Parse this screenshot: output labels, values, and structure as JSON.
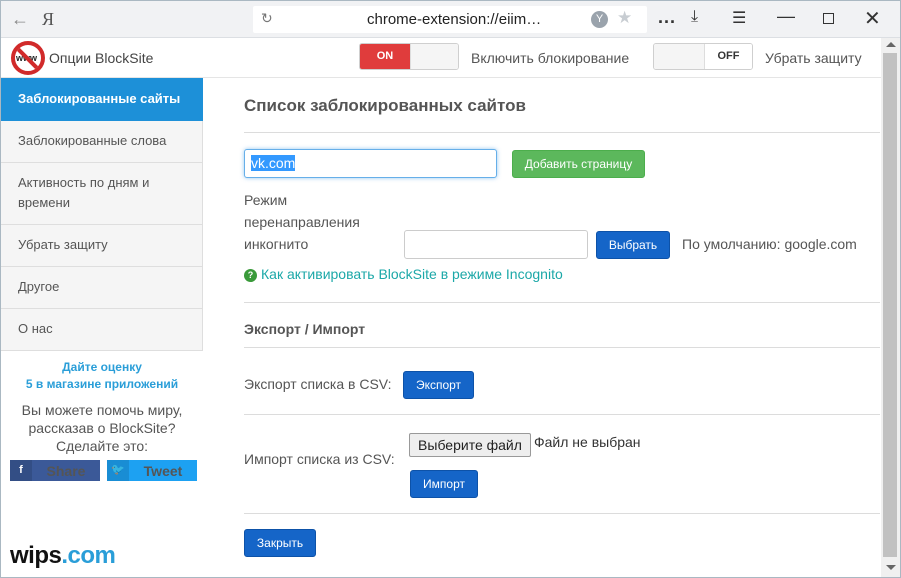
{
  "browser": {
    "back_glyph": "←",
    "ya_logo": "Я",
    "refresh_glyph": "↻",
    "url": "chrome-extension://eiim…",
    "ext_badge": "Y",
    "star_glyph": "★",
    "dots": "...",
    "download_glyph": "⤓",
    "menu_glyph": "☰",
    "minimize_glyph": "—",
    "close_glyph": "✕"
  },
  "header": {
    "app_title": "Опции BlockSite",
    "logo_text": "www",
    "toggle_block_state": "ON",
    "toggle_block_label": "Включить блокирование",
    "toggle_protect_state": "OFF",
    "toggle_protect_label": "Убрать защиту"
  },
  "sidebar": {
    "items": [
      {
        "label": "Заблокированные сайты",
        "active": true
      },
      {
        "label": "Заблокированные слова"
      },
      {
        "label": "Активность по дням и времени"
      },
      {
        "label": "Убрать защиту"
      },
      {
        "label": "Другое"
      },
      {
        "label": "О нас"
      }
    ],
    "rate_line1": "Дайте оценку",
    "rate_line2": "5 в магазине приложений",
    "help_line1": "Вы можете помочь миру,",
    "help_line2": "рассказав о BlockSite?",
    "help_line3": "Сделайте это:",
    "share_fb_icon": "f",
    "share_fb": "Share",
    "share_tw_icon": "🐦",
    "share_tw": "Tweet",
    "brand_main": "wips",
    "brand_dot": ".",
    "brand_tail": "com"
  },
  "main": {
    "title": "Список заблокированных сайтов",
    "site_input_value": "vk.com",
    "add_button": "Добавить страницу",
    "incognito_label_1": "Режим",
    "incognito_label_2": "перенаправления",
    "incognito_label_3": "инкогнито",
    "redirect_input_value": "",
    "choose_button": "Выбрать",
    "default_text": "По умолчанию: google.com",
    "hint_icon": "?",
    "hint_link": "Как активировать BlockSite в режиме Incognito",
    "export_import_title": "Экспорт / Импорт",
    "export_label": "Экспорт списка в CSV:",
    "export_button": "Экспорт",
    "import_label": "Импорт списка из CSV:",
    "file_button": "Выберите файл",
    "file_none": "Файл не выбран",
    "import_button": "Импорт",
    "close_button": "Закрыть"
  },
  "colors": {
    "accent_blue": "#1d90d8",
    "toggle_on_red": "#e03c3c",
    "add_green": "#5cb85c",
    "button_blue": "#1565c8",
    "link_teal": "#1ca8a8"
  }
}
